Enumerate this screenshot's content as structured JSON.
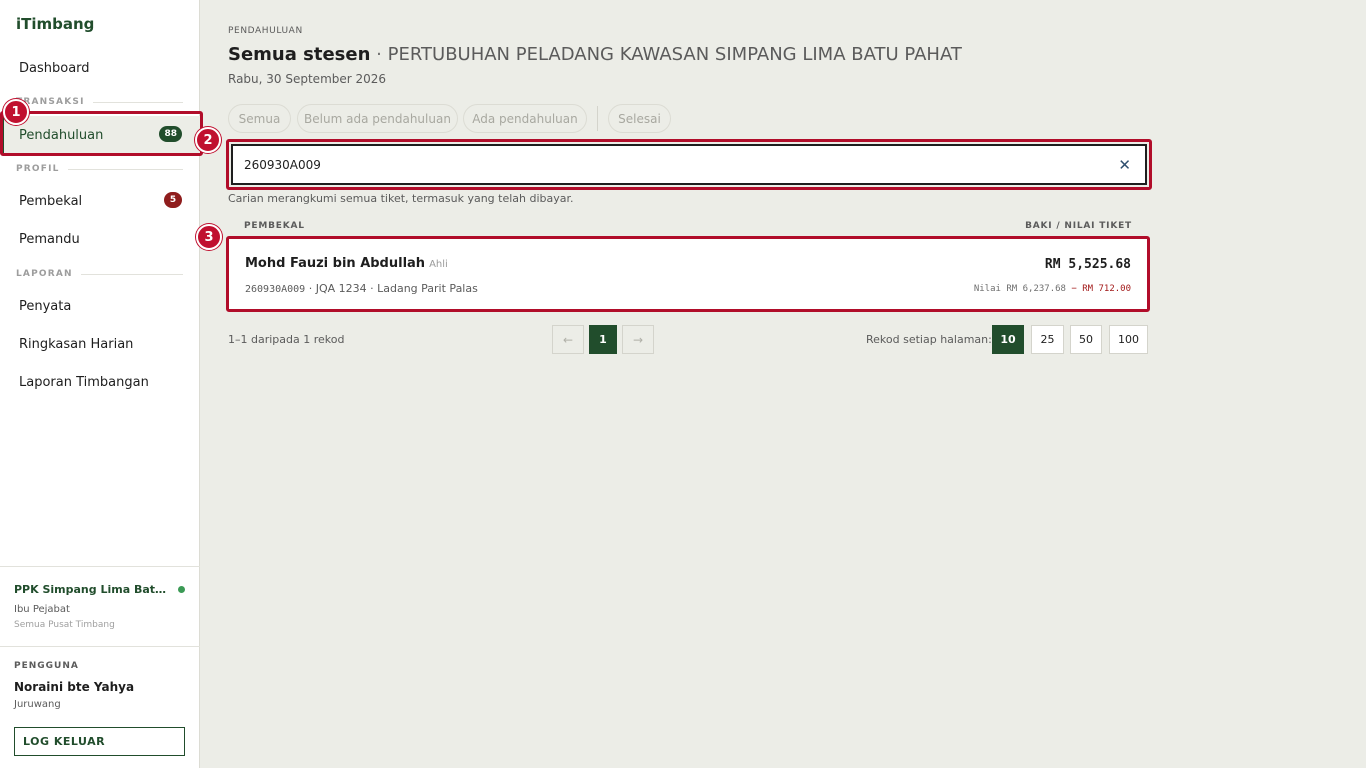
{
  "app": {
    "brand": "iTimbang"
  },
  "sidebar": {
    "dashboard": "Dashboard",
    "section_transaksi": "TRANSAKSI",
    "pendahuluan": {
      "label": "Pendahuluan",
      "badge": "88"
    },
    "section_profil": "PROFIL",
    "pembekal": {
      "label": "Pembekal",
      "badge": "5"
    },
    "pemandu": "Pemandu",
    "section_laporan": "LAPORAN",
    "penyata": "Penyata",
    "ringkasan": "Ringkasan Harian",
    "laporan_timbangan": "Laporan Timbangan"
  },
  "station": {
    "name": "PPK Simpang Lima Batu P...",
    "office": "Ibu Pejabat",
    "scope": "Semua Pusat Timbang"
  },
  "user": {
    "label": "PENGGUNA",
    "name": "Noraini bte Yahya",
    "role": "Juruwang",
    "logout": "LOG KELUAR"
  },
  "header": {
    "breadcrumb": "PENDAHULUAN",
    "title": "Semua stesen",
    "separator": " · ",
    "org": "PERTUBUHAN PELADANG KAWASAN SIMPANG LIMA BATU PAHAT",
    "date": "Rabu, 30 September 2026"
  },
  "filters": [
    "Semua",
    "Belum ada pendahuluan",
    "Ada pendahuluan",
    "Selesai"
  ],
  "search": {
    "value": "260930A009",
    "clear_glyph": "✕",
    "hint": "Carian merangkumi semua tiket, termasuk yang telah dibayar."
  },
  "table": {
    "col_left": "PEMBEKAL",
    "col_right": "BAKI / NILAI TIKET",
    "rows": [
      {
        "name": "Mohd Fauzi bin Abdullah",
        "type": "Ahli",
        "ticket": "260930A009",
        "meta": " · JQA 1234 · Ladang Parit Palas",
        "amount": "RM 5,525.68",
        "detail_value": "Nilai RM 6,237.68",
        "detail_minus": " − RM 712.00"
      }
    ]
  },
  "pagination": {
    "summary": "1–1 daripada 1 rekod",
    "prev": "←",
    "current": "1",
    "next": "→",
    "per_page_label": "Rekod setiap halaman:",
    "per_page_options": [
      "10",
      "25",
      "50",
      "100"
    ],
    "per_page_selected": "10"
  },
  "annotations": [
    "1",
    "2",
    "3"
  ],
  "colors": {
    "primary": "#214d2c",
    "highlight": "#b10d2a",
    "danger": "#8f1d1d",
    "background": "#ecede7"
  }
}
